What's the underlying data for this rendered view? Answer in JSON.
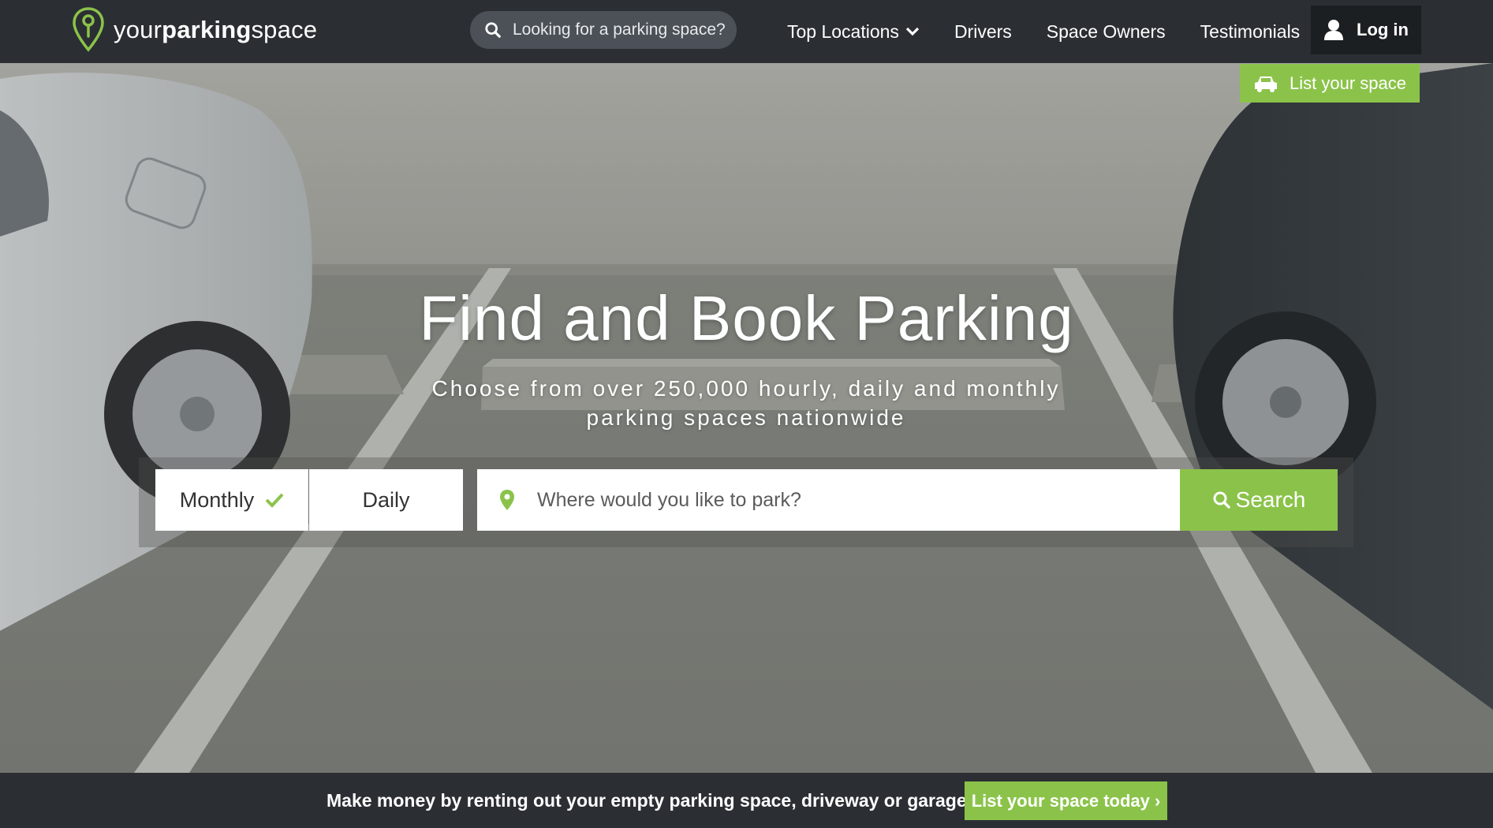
{
  "brand": {
    "name_part1": "your",
    "name_part2": "parking",
    "name_part3": "space",
    "accent_color": "#8bc34a"
  },
  "nav": {
    "search_placeholder": "Looking for a parking space?",
    "links": [
      "Top Locations",
      "Drivers",
      "Space Owners",
      "Testimonials"
    ],
    "login_label": "Log in"
  },
  "hero": {
    "list_space_label": "List your space",
    "title": "Find and Book Parking",
    "subtitle_line1": "Choose from over 250,000 hourly, daily and monthly",
    "subtitle_line2": "parking spaces nationwide",
    "modes": {
      "monthly": "Monthly",
      "daily": "Daily",
      "selected": "Monthly"
    },
    "location_placeholder": "Where would you like to park?",
    "search_label": "Search"
  },
  "footer_bar": {
    "message": "Make money by renting out your empty parking space, driveway or garage.",
    "cta_label": "List your space today ›"
  },
  "icons": {
    "logo": "map-pin-logo-icon",
    "search": "magnifier-icon",
    "dropdown": "chevron-down-icon",
    "user": "user-icon",
    "car": "car-icon",
    "check": "checkmark-icon",
    "location": "map-marker-icon"
  }
}
